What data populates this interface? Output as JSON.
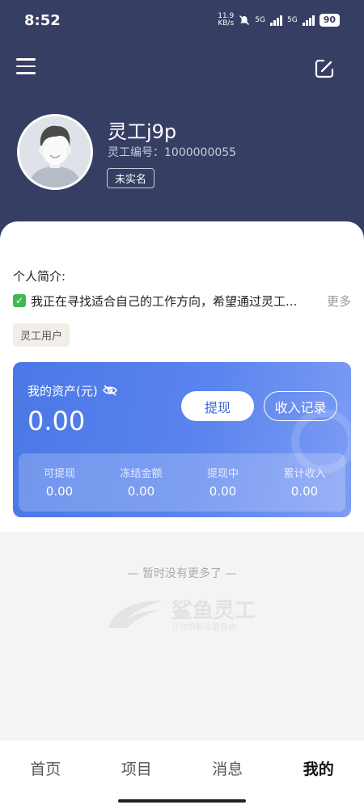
{
  "status_bar": {
    "time": "8:52",
    "net_speed_value": "11.9",
    "net_speed_unit": "KB/s",
    "network_1": "5G",
    "network_2": "5G",
    "battery": "90"
  },
  "header": {
    "menu_icon": "menu-icon",
    "edit_icon": "edit-icon",
    "username": "灵工j9p",
    "user_id": "灵工编号：1000000055",
    "verify_status": "未实名"
  },
  "profile": {
    "intro_title": "个人简介:",
    "intro_text": "我正在寻找适合自己的工作方向，希望通过灵工...",
    "more_label": "更多",
    "tag": "灵工用户"
  },
  "assets": {
    "label": "我的资产(元)",
    "amount": "0.00",
    "withdraw_label": "提现",
    "income_record_label": "收入记录",
    "stats": [
      {
        "label": "可提现",
        "value": "0.00"
      },
      {
        "label": "冻结金额",
        "value": "0.00"
      },
      {
        "label": "提现中",
        "value": "0.00"
      },
      {
        "label": "累计收入",
        "value": "0.00"
      }
    ]
  },
  "empty_state": {
    "no_more": "— 暂时没有更多了 —",
    "brand_name": "鲨鱼灵工",
    "brand_slogan": "让你的职业更自由"
  },
  "bottom_nav": {
    "items": [
      {
        "label": "首页"
      },
      {
        "label": "项目"
      },
      {
        "label": "消息"
      },
      {
        "label": "我的"
      }
    ],
    "active": "我的"
  },
  "colors": {
    "header_bg": "#363e63",
    "card_gradient_start": "#4a78e6",
    "card_gradient_end": "#7d9cf5",
    "check_green": "#3fb950"
  }
}
